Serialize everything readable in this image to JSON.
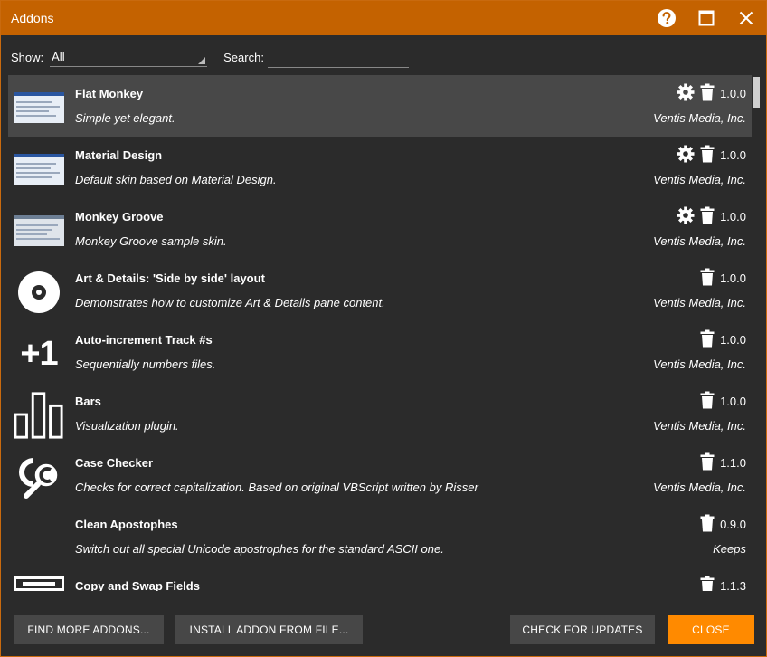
{
  "window": {
    "title": "Addons"
  },
  "toolbar": {
    "show_label": "Show:",
    "show_value": "All",
    "search_label": "Search:",
    "search_value": ""
  },
  "addons": [
    {
      "name": "Flat Monkey",
      "description": "Simple yet elegant.",
      "version": "1.0.0",
      "author": "Ventis Media, Inc.",
      "icon": "skin-thumbnail",
      "has_settings": true
    },
    {
      "name": "Material Design",
      "description": "Default skin based on Material Design.",
      "version": "1.0.0",
      "author": "Ventis Media, Inc.",
      "icon": "skin-thumbnail",
      "has_settings": true
    },
    {
      "name": "Monkey Groove",
      "description": "Monkey Groove sample skin.",
      "version": "1.0.0",
      "author": "Ventis Media, Inc.",
      "icon": "skin-thumbnail",
      "has_settings": true
    },
    {
      "name": "Art & Details: 'Side by side' layout",
      "description": "Demonstrates how to customize Art & Details pane content.",
      "version": "1.0.0",
      "author": "Ventis Media, Inc.",
      "icon": "disc-icon",
      "has_settings": false
    },
    {
      "name": "Auto-increment Track #s",
      "description": "Sequentially numbers files.",
      "version": "1.0.0",
      "author": "Ventis Media, Inc.",
      "icon": "plus-one-icon",
      "icon_text": "+1",
      "has_settings": false
    },
    {
      "name": "Bars",
      "description": "Visualization plugin.",
      "version": "1.0.0",
      "author": "Ventis Media, Inc.",
      "icon": "bars-icon",
      "has_settings": false
    },
    {
      "name": "Case Checker",
      "description": "Checks for correct capitalization. Based on original VBScript written by Risser",
      "version": "1.1.0",
      "author": "Ventis Media, Inc.",
      "icon": "case-checker-icon",
      "has_settings": false
    },
    {
      "name": "Clean Apostophes",
      "description": "Switch out all special Unicode apostrophes for the standard ASCII one.",
      "version": "0.9.0",
      "author": "Keeps",
      "icon": "none",
      "has_settings": false
    },
    {
      "name": "Copy and Swap Fields",
      "description": "",
      "version": "1.1.3",
      "author": "",
      "icon": "copy-swap-icon",
      "has_settings": false
    }
  ],
  "buttons": {
    "find_more": "FIND MORE ADDONS...",
    "install": "INSTALL ADDON FROM FILE...",
    "check_updates": "CHECK FOR UPDATES",
    "close": "CLOSE"
  },
  "colors": {
    "accent": "#c46200",
    "primary_button": "#ff8a00",
    "selected_row": "#484848",
    "background": "#2b2b2b"
  }
}
